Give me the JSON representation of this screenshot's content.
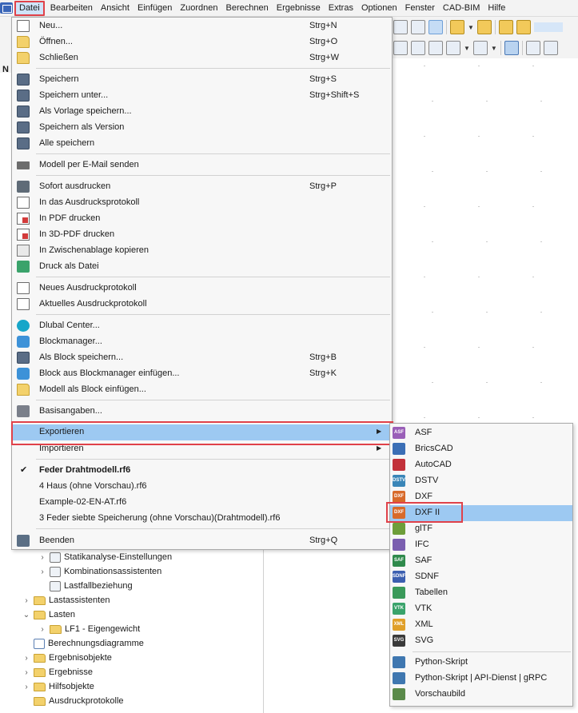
{
  "menubar": {
    "items": [
      "Datei",
      "Bearbeiten",
      "Ansicht",
      "Einfügen",
      "Zuordnen",
      "Berechnen",
      "Ergebnisse",
      "Extras",
      "Optionen",
      "Fenster",
      "CAD-BIM",
      "Hilfe"
    ],
    "active": "Datei"
  },
  "left_strip": {
    "letter": "N"
  },
  "datei_menu": {
    "items": [
      {
        "label": "Neu...",
        "shortcut": "Strg+N",
        "icon": "new-document-icon"
      },
      {
        "label": "Öffnen...",
        "shortcut": "Strg+O",
        "icon": "open-folder-icon"
      },
      {
        "label": "Schließen",
        "shortcut": "Strg+W",
        "icon": "close-folder-icon"
      },
      {
        "label": "Speichern",
        "shortcut": "Strg+S",
        "icon": "save-icon"
      },
      {
        "label": "Speichern unter...",
        "shortcut": "Strg+Shift+S",
        "icon": "save-as-icon"
      },
      {
        "label": "Als Vorlage speichern...",
        "shortcut": "",
        "icon": "save-template-icon"
      },
      {
        "label": "Speichern als Version",
        "shortcut": "",
        "icon": "save-version-icon"
      },
      {
        "label": "Alle speichern",
        "shortcut": "",
        "icon": "save-all-icon"
      },
      {
        "label": "Modell per E-Mail senden",
        "shortcut": "",
        "icon": "email-icon"
      },
      {
        "label": "Sofort ausdrucken",
        "shortcut": "Strg+P",
        "icon": "printer-icon"
      },
      {
        "label": "In das Ausdrucksprotokoll",
        "shortcut": "",
        "icon": "print-report-icon"
      },
      {
        "label": "In PDF drucken",
        "shortcut": "",
        "icon": "pdf-icon"
      },
      {
        "label": "In 3D-PDF drucken",
        "shortcut": "",
        "icon": "pdf-3d-icon"
      },
      {
        "label": "In Zwischenablage kopieren",
        "shortcut": "",
        "icon": "clipboard-icon"
      },
      {
        "label": "Druck als Datei",
        "shortcut": "",
        "icon": "print-file-icon"
      },
      {
        "label": "Neues Ausdruckprotokoll",
        "shortcut": "",
        "icon": "new-report-icon"
      },
      {
        "label": "Aktuelles Ausdruckprotokoll",
        "shortcut": "",
        "icon": "current-report-icon"
      },
      {
        "label": "Dlubal Center...",
        "shortcut": "",
        "icon": "dlubal-center-icon"
      },
      {
        "label": "Blockmanager...",
        "shortcut": "",
        "icon": "block-manager-icon"
      },
      {
        "label": "Als Block speichern...",
        "shortcut": "Strg+B",
        "icon": "save-block-icon"
      },
      {
        "label": "Block aus Blockmanager einfügen...",
        "shortcut": "Strg+K",
        "icon": "insert-block-icon"
      },
      {
        "label": "Modell als Block einfügen...",
        "shortcut": "",
        "icon": "model-block-icon"
      },
      {
        "label": "Basisangaben...",
        "shortcut": "",
        "icon": "base-data-icon"
      },
      {
        "label": "Exportieren",
        "shortcut": "",
        "icon": ""
      },
      {
        "label": "Importieren",
        "shortcut": "",
        "icon": ""
      },
      {
        "label": "Feder Drahtmodell.rf6",
        "shortcut": "",
        "icon": "check-icon"
      },
      {
        "label": "4 Haus (ohne Vorschau).rf6",
        "shortcut": "",
        "icon": ""
      },
      {
        "label": "Example-02-EN-AT.rf6",
        "shortcut": "",
        "icon": ""
      },
      {
        "label": "3 Feder siebte Speicherung (ohne Vorschau)(Drahtmodell).rf6",
        "shortcut": "",
        "icon": ""
      },
      {
        "label": "Beenden",
        "shortcut": "Strg+Q",
        "icon": "exit-icon"
      }
    ]
  },
  "export_submenu": {
    "items": [
      {
        "label": "ASF",
        "icon": "asf-icon",
        "tag": "ASF",
        "color": "#9a5fb8"
      },
      {
        "label": "BricsCAD",
        "icon": "bricscad-icon",
        "tag": "",
        "color": "#3b6fb6"
      },
      {
        "label": "AutoCAD",
        "icon": "autocad-icon",
        "tag": "",
        "color": "#c2313a"
      },
      {
        "label": "DSTV",
        "icon": "dstv-icon",
        "tag": "DSTV",
        "color": "#3a86b8"
      },
      {
        "label": "DXF",
        "icon": "dxf-icon",
        "tag": "DXF",
        "color": "#d86a2a"
      },
      {
        "label": "DXF II",
        "icon": "dxf-ii-icon",
        "tag": "DXF",
        "color": "#d86a2a"
      },
      {
        "label": "glTF",
        "icon": "gltf-icon",
        "tag": "",
        "color": "#6e9e3a"
      },
      {
        "label": "IFC",
        "icon": "ifc-icon",
        "tag": "",
        "color": "#7b5fb0"
      },
      {
        "label": "SAF",
        "icon": "saf-icon",
        "tag": "SAF",
        "color": "#2f8a4c"
      },
      {
        "label": "SDNF",
        "icon": "sdnf-icon",
        "tag": "SDNF",
        "color": "#3c5fb0"
      },
      {
        "label": "Tabellen",
        "icon": "tables-icon",
        "tag": "",
        "color": "#3a9a5a"
      },
      {
        "label": "VTK",
        "icon": "vtk-icon",
        "tag": "VTK",
        "color": "#3aa36b"
      },
      {
        "label": "XML",
        "icon": "xml-icon",
        "tag": "XML",
        "color": "#e0a02a"
      },
      {
        "label": "SVG",
        "icon": "svg-icon",
        "tag": "SVG",
        "color": "#3a3a3a"
      },
      {
        "label": "Python-Skript",
        "icon": "python-icon",
        "tag": "",
        "color": "#3f77b0"
      },
      {
        "label": "Python-Skript | API-Dienst | gRPC",
        "icon": "python-grpc-icon",
        "tag": "",
        "color": "#3f77b0"
      },
      {
        "label": "Vorschaubild",
        "icon": "preview-image-icon",
        "tag": "",
        "color": "#5a8a4a"
      }
    ]
  },
  "tree": {
    "items": [
      {
        "label": "Statikanalyse-Einstellungen"
      },
      {
        "label": "Kombinationsassistenten"
      },
      {
        "label": "Lastfallbeziehung"
      },
      {
        "label": "Lastassistenten"
      },
      {
        "label": "Lasten"
      },
      {
        "label": "LF1 - Eigengewicht"
      },
      {
        "label": "Berechnungsdiagramme"
      },
      {
        "label": "Ergebnisobjekte"
      },
      {
        "label": "Ergebnisse"
      },
      {
        "label": "Hilfsobjekte"
      },
      {
        "label": "Ausdruckprotokolle"
      }
    ]
  },
  "colors": {
    "highlight": "#9dc9f2",
    "annotation_red": "#e0424a"
  }
}
